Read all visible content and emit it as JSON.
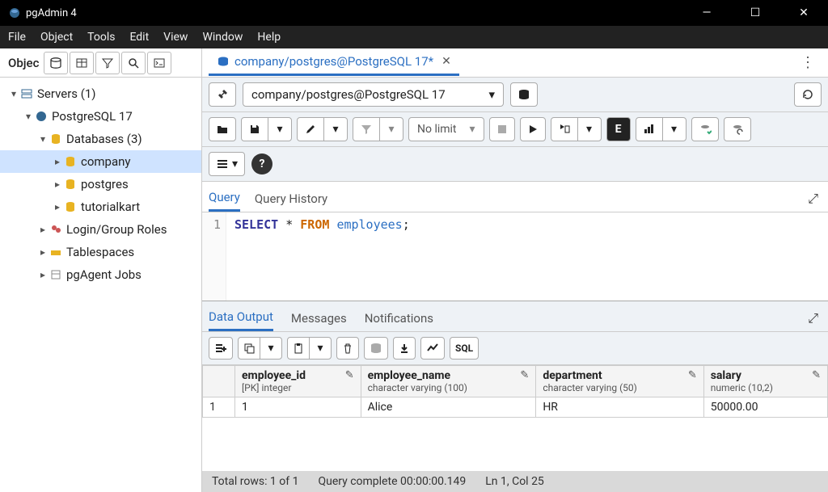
{
  "app": {
    "title": "pgAdmin 4"
  },
  "menus": [
    "File",
    "Object",
    "Tools",
    "Edit",
    "View",
    "Window",
    "Help"
  ],
  "sidebar": {
    "title": "Objec",
    "tree": {
      "servers": {
        "label": "Servers (1)"
      },
      "server1": {
        "label": "PostgreSQL 17"
      },
      "databases": {
        "label": "Databases (3)"
      },
      "db_company": {
        "label": "company"
      },
      "db_postgres": {
        "label": "postgres"
      },
      "db_tutorialkart": {
        "label": "tutorialkart"
      },
      "login_roles": {
        "label": "Login/Group Roles"
      },
      "tablespaces": {
        "label": "Tablespaces"
      },
      "pgagent": {
        "label": "pgAgent Jobs"
      }
    }
  },
  "fileTab": {
    "label": "company/postgres@PostgreSQL 17*"
  },
  "connection": {
    "label": "company/postgres@PostgreSQL 17"
  },
  "limitSelect": "No limit",
  "queryTabs": {
    "query": "Query",
    "history": "Query History"
  },
  "editor": {
    "lineNumber": "1",
    "tokens": {
      "select": "SELECT",
      "star": "*",
      "from": "FROM",
      "table": "employees",
      "semi": ";"
    }
  },
  "outputTabs": {
    "data": "Data Output",
    "messages": "Messages",
    "notifications": "Notifications"
  },
  "sqlBtn": "SQL",
  "grid": {
    "columns": [
      {
        "name": "employee_id",
        "meta": "[PK] integer"
      },
      {
        "name": "employee_name",
        "meta": "character varying (100)"
      },
      {
        "name": "department",
        "meta": "character varying (50)"
      },
      {
        "name": "salary",
        "meta": "numeric (10,2)"
      }
    ],
    "rows": [
      {
        "num": "1",
        "employee_id": "1",
        "employee_name": "Alice",
        "department": "HR",
        "salary": "50000.00"
      }
    ]
  },
  "status": {
    "totalRows": "Total rows: 1 of 1",
    "queryComplete": "Query complete 00:00:00.149",
    "cursor": "Ln 1, Col 25"
  }
}
